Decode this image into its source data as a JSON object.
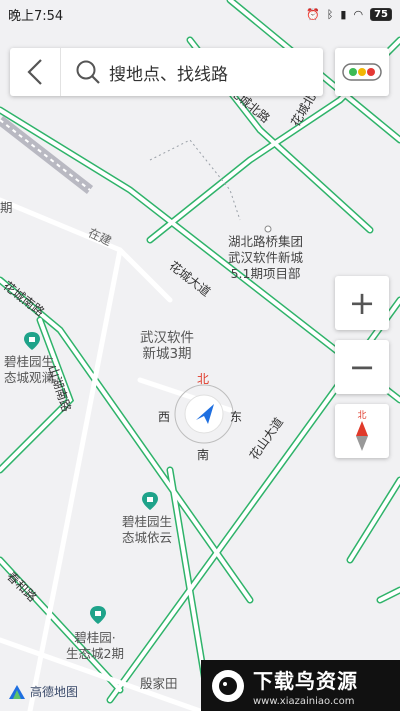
{
  "status_bar": {
    "time": "晚上7:54",
    "battery": "75"
  },
  "search": {
    "placeholder": "搜地点、找线路"
  },
  "map": {
    "poi_labels": [
      {
        "text": "湖北路桥集团\n武汉软件新城\n5.1期项目部"
      },
      {
        "text": "武汉软件\n新城3期"
      },
      {
        "text": "碧桂园生\n态城观澜"
      },
      {
        "text": "碧桂园生\n态城依云"
      },
      {
        "text": "碧桂园·\n生态城2期"
      },
      {
        "text": "殷家田"
      },
      {
        "text": "期"
      }
    ],
    "road_labels": [
      {
        "text": "花城大道"
      },
      {
        "text": "花城南路"
      },
      {
        "text": "花山大道"
      },
      {
        "text": "山湖南路"
      },
      {
        "text": "春和路"
      },
      {
        "text": "花城北路"
      },
      {
        "text": "花城北路"
      },
      {
        "text": "在建"
      }
    ]
  },
  "compass": {
    "north": "北",
    "south": "南",
    "east": "东",
    "west": "西"
  },
  "controls": {
    "zoom_in": "+",
    "zoom_out": "−",
    "compass_north": "北"
  },
  "logo": {
    "text": "高德地图"
  },
  "watermark": {
    "text": "下载鸟资源",
    "url": "www.xiazainiao.com"
  },
  "colors": {
    "road_green": "#2fb36a",
    "accent_blue": "#1f6fe0",
    "north_red": "#e03a2a"
  }
}
